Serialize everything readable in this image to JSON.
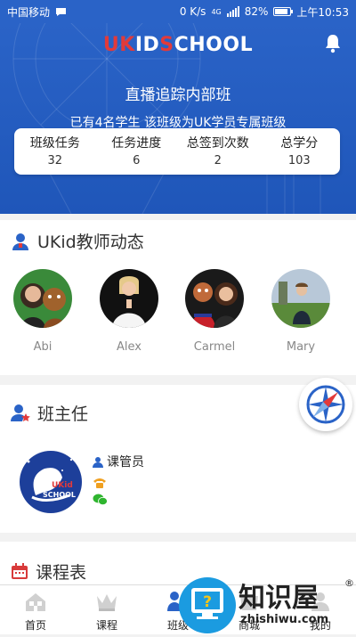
{
  "status_bar": {
    "carrier": "中国移动",
    "speed": "0 K/s",
    "network": "4G",
    "battery": "82%",
    "battery_level": 0.82,
    "time": "上午10:53"
  },
  "header": {
    "logo": {
      "part1": "U",
      "part2": "K",
      "part3": "ID",
      "part4": "S",
      "part5": "CHOOL"
    },
    "class_name": "直播追踪内部班",
    "class_subtitle": "已有4名学生  该班级为UK学员专属班级"
  },
  "stats": [
    {
      "label": "班级任务",
      "value": "32"
    },
    {
      "label": "任务进度",
      "value": "6"
    },
    {
      "label": "总签到次数",
      "value": "2"
    },
    {
      "label": "总学分",
      "value": "103"
    }
  ],
  "teacher_section": {
    "title": "UKid教师动态",
    "teachers": [
      {
        "name": "Abi"
      },
      {
        "name": "Alex"
      },
      {
        "name": "Carmel"
      },
      {
        "name": "Mary"
      }
    ]
  },
  "head_teacher_section": {
    "title": "班主任",
    "role": "课管员",
    "avatar_logo": {
      "part1": "UKid",
      "part2": "SCHOOL"
    }
  },
  "schedule_section": {
    "title": "课程表"
  },
  "tabbar": {
    "tabs": [
      {
        "label": "首页"
      },
      {
        "label": "课程"
      },
      {
        "label": "班级"
      },
      {
        "label": "商城"
      },
      {
        "label": "我的"
      }
    ]
  },
  "watermark": {
    "text": "知识屋",
    "url": "zhishiwu.com",
    "reg": "®"
  },
  "colors": {
    "primary": "#2a63c7",
    "red": "#e23a3a",
    "help": "#1b9be0"
  }
}
